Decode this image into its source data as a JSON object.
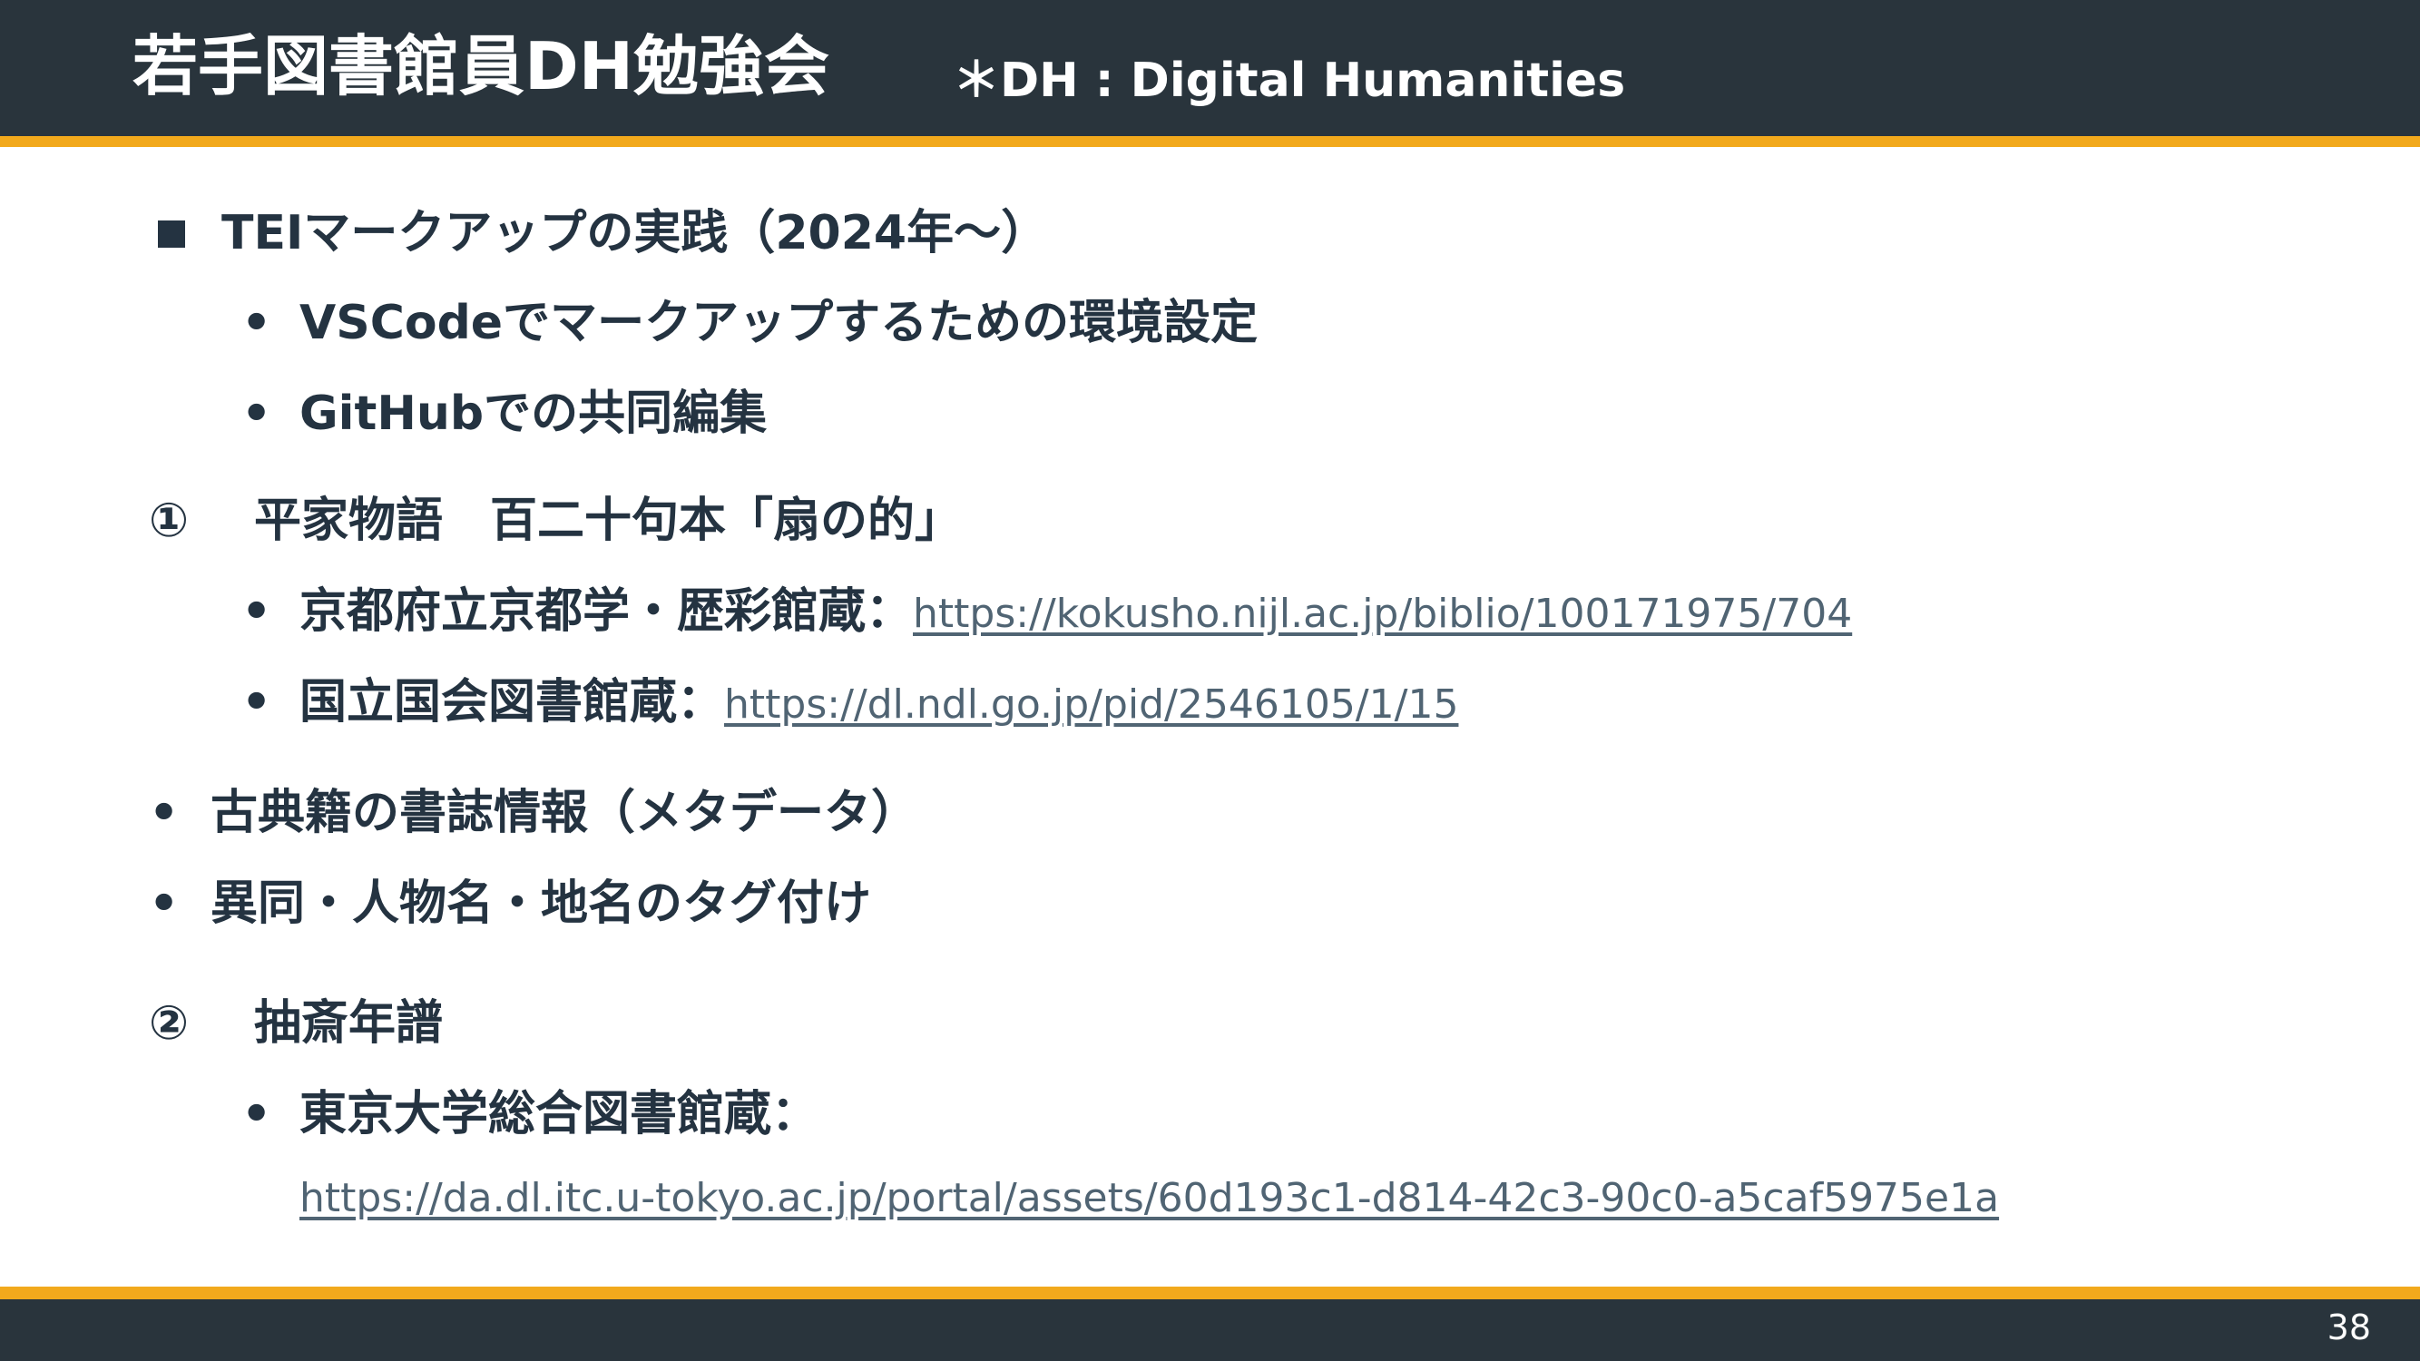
{
  "header": {
    "title": "若手図書館員DH勉強会",
    "subtitle": "＊DH : Digital Humanities"
  },
  "content": {
    "section_tei": {
      "marker": "■",
      "text": "TEIマークアップの実践（2024年～）",
      "bullets": [
        "VSCodeでマークアップするための環境設定",
        "GitHubでの共同編集"
      ]
    },
    "item1": {
      "marker": "①",
      "text": "平家物語　百二十句本「扇の的」",
      "sources": [
        {
          "label": "京都府立京都学・歴彩館蔵：",
          "url": "https://kokusho.nijl.ac.jp/biblio/100171975/704"
        },
        {
          "label": "国立国会図書館蔵：",
          "url": "https://dl.ndl.go.jp/pid/2546105/1/15"
        }
      ],
      "bullets": [
        "古典籍の書誌情報（メタデータ）",
        "異同・人物名・地名のタグ付け"
      ]
    },
    "item2": {
      "marker": "②",
      "text": "抽斎年譜",
      "sources": [
        {
          "label": "東京大学総合図書館蔵：",
          "url": "https://da.dl.itc.u-tokyo.ac.jp/portal/assets/60d193c1-d814-42c3-90c0-a5caf5975e1a"
        }
      ]
    },
    "bullet_char": "•"
  },
  "footer": {
    "page_number": "38"
  },
  "colors": {
    "header_bg": "#29343c",
    "accent": "#f2a91c",
    "text": "#243341",
    "link": "#506473"
  }
}
